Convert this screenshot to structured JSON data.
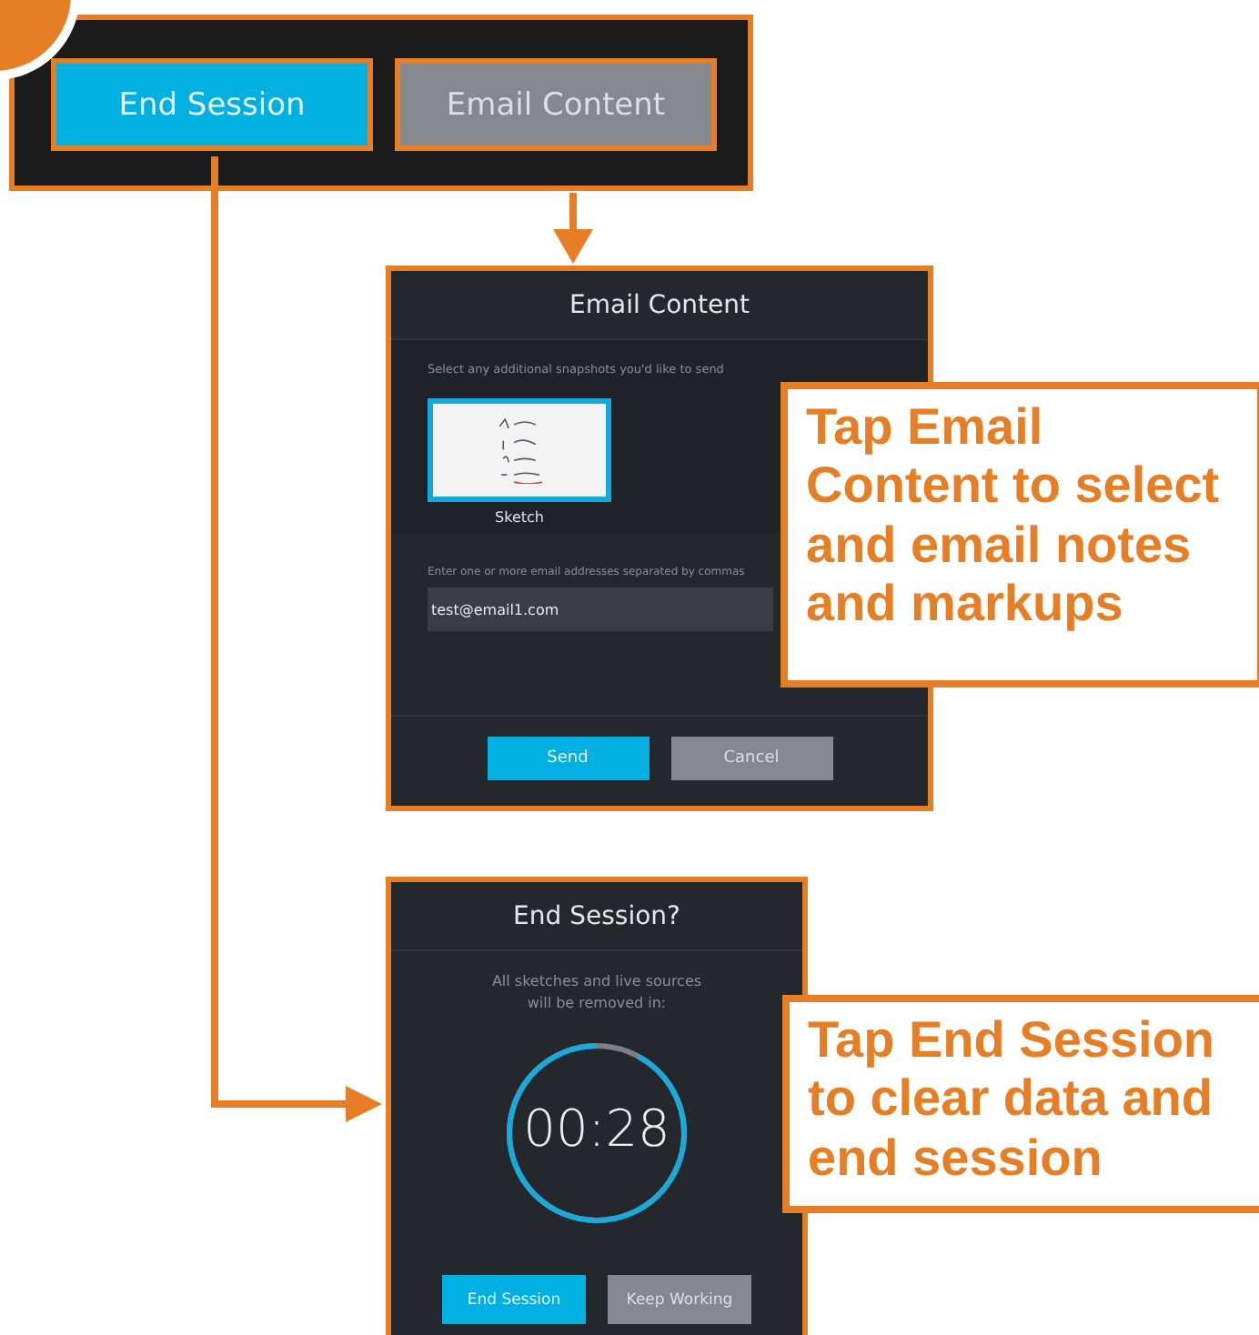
{
  "toolbar": {
    "buttons": [
      {
        "label": "End Session",
        "kind": "primary"
      },
      {
        "label": "Email Content",
        "kind": "secondary"
      }
    ]
  },
  "email_dialog": {
    "title": "Email Content",
    "instruction": "Select any additional snapshots you'd like to send",
    "snapshots": [
      {
        "label": "Sketch",
        "selected": true
      }
    ],
    "address_label": "Enter one or more email addresses separated by commas",
    "address_value": "test@email1.com",
    "buttons": [
      {
        "label": "Send",
        "kind": "primary"
      },
      {
        "label": "Cancel",
        "kind": "secondary"
      }
    ]
  },
  "end_dialog": {
    "title": "End Session?",
    "message": "All sketches and live sources will be removed in:",
    "countdown": "00:28",
    "level": 0.92,
    "buttons": [
      {
        "label": "End Session",
        "kind": "primary"
      },
      {
        "label": "Keep Working",
        "kind": "secondary"
      }
    ]
  },
  "callouts": [
    "Tap Email Content to select and email notes and markups",
    "Tap End Session to clear data and end session"
  ]
}
